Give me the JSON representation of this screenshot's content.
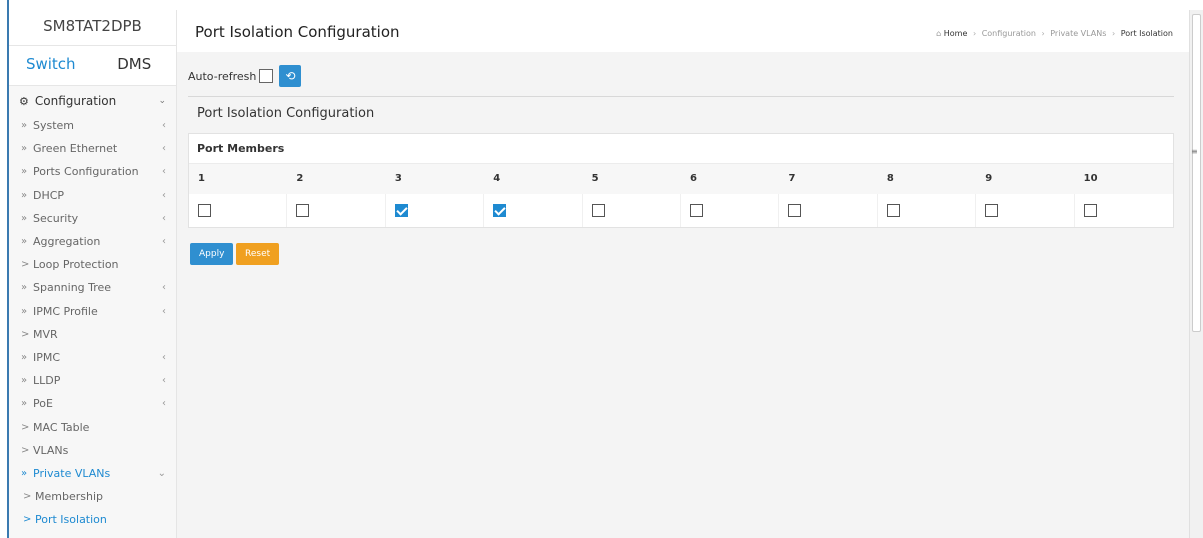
{
  "sidebar": {
    "brand": "SM8TAT2DPB",
    "tabs": [
      {
        "label": "Switch",
        "active": true
      },
      {
        "label": "DMS",
        "active": false
      }
    ],
    "section": {
      "label": "Configuration",
      "icon": "gear-icon"
    },
    "items": [
      {
        "label": "System",
        "prefix": "»",
        "chevron": "‹"
      },
      {
        "label": "Green Ethernet",
        "prefix": "»",
        "chevron": "‹"
      },
      {
        "label": "Ports Configuration",
        "prefix": "»",
        "chevron": "‹"
      },
      {
        "label": "DHCP",
        "prefix": "»",
        "chevron": "‹"
      },
      {
        "label": "Security",
        "prefix": "»",
        "chevron": "‹"
      },
      {
        "label": "Aggregation",
        "prefix": "»",
        "chevron": "‹"
      },
      {
        "label": "Loop Protection",
        "prefix": ">",
        "chevron": ""
      },
      {
        "label": "Spanning Tree",
        "prefix": "»",
        "chevron": "‹"
      },
      {
        "label": "IPMC Profile",
        "prefix": "»",
        "chevron": "‹"
      },
      {
        "label": "MVR",
        "prefix": ">",
        "chevron": ""
      },
      {
        "label": "IPMC",
        "prefix": "»",
        "chevron": "‹"
      },
      {
        "label": "LLDP",
        "prefix": "»",
        "chevron": "‹"
      },
      {
        "label": "PoE",
        "prefix": "»",
        "chevron": "‹"
      },
      {
        "label": "MAC Table",
        "prefix": ">",
        "chevron": ""
      },
      {
        "label": "VLANs",
        "prefix": ">",
        "chevron": ""
      },
      {
        "label": "Private VLANs",
        "prefix": "»",
        "chevron": "⌄"
      }
    ],
    "subitems": [
      {
        "label": "Membership",
        "prefix": ">"
      },
      {
        "label": "Port Isolation",
        "prefix": ">"
      }
    ]
  },
  "header": {
    "title": "Port Isolation Configuration",
    "breadcrumb": [
      "Home",
      "Configuration",
      "Private VLANs",
      "Port Isolation"
    ]
  },
  "toolbar": {
    "auto_refresh_label": "Auto-refresh",
    "auto_refresh_checked": false,
    "refresh_icon": "refresh-icon"
  },
  "section_title": "Port Isolation Configuration",
  "table": {
    "header": "Port Members",
    "ports": [
      "1",
      "2",
      "3",
      "4",
      "5",
      "6",
      "7",
      "8",
      "9",
      "10"
    ],
    "checked": [
      false,
      false,
      true,
      true,
      false,
      false,
      false,
      false,
      false,
      false
    ]
  },
  "buttons": {
    "apply": "Apply",
    "reset": "Reset"
  },
  "colors": {
    "accent": "#1e8ad1",
    "reset": "#f0a020"
  }
}
